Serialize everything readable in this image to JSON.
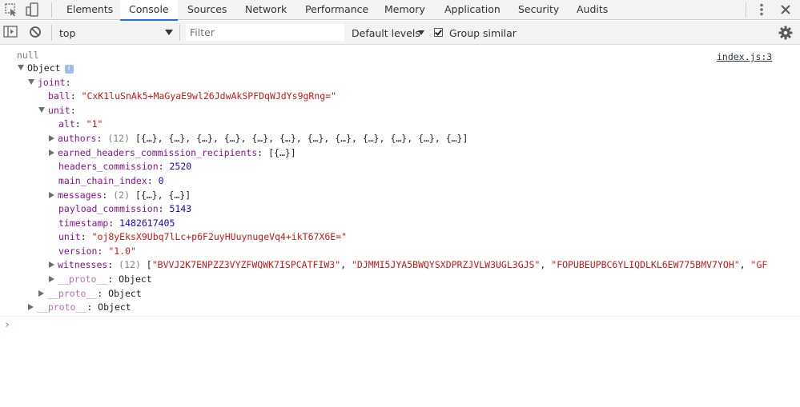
{
  "tabs": [
    {
      "label": "Elements"
    },
    {
      "label": "Console",
      "active": true
    },
    {
      "label": "Sources"
    },
    {
      "label": "Network"
    },
    {
      "label": "Performance"
    },
    {
      "label": "Memory"
    },
    {
      "label": "Application"
    },
    {
      "label": "Security"
    },
    {
      "label": "Audits"
    }
  ],
  "toolbar": {
    "context": "top",
    "filter_placeholder": "Filter",
    "levels": "Default levels",
    "group_similar": "Group similar",
    "group_similar_checked": true
  },
  "console": {
    "null_text": "null",
    "source_link": "index.js:3",
    "root_label": "Object",
    "info_badge": "i",
    "joint_key": "joint",
    "ball_key": "ball",
    "ball_value": "\"CxK1luSnAk5+MaGyaE9wl26JdwAkSPFDqWJdYs9gRng=\"",
    "unit_key": "unit",
    "alt_key": "alt",
    "alt_value": "\"1\"",
    "authors_key": "authors",
    "authors_count": "(12)",
    "authors_preview": "[{…}, {…}, {…}, {…}, {…}, {…}, {…}, {…}, {…}, {…}, {…}, {…}]",
    "earned_key": "earned_headers_commission_recipients",
    "earned_preview": "[{…}]",
    "hc_key": "headers_commission",
    "hc_value": "2520",
    "mci_key": "main_chain_index",
    "mci_value": "0",
    "messages_key": "messages",
    "messages_count": "(2)",
    "messages_preview": "[{…}, {…}]",
    "pc_key": "payload_commission",
    "pc_value": "5143",
    "ts_key": "timestamp",
    "ts_value": "1482617405",
    "unit2_key": "unit",
    "unit2_value": "\"oj8yEksX9Ubq7lLc+p6F2uyHUuynugeVq4+ikT67X6E=\"",
    "version_key": "version",
    "version_value": "\"1.0\"",
    "witnesses_key": "witnesses",
    "witnesses_count": "(12)",
    "w1": "\"BVVJ2K7ENPZZ3VYZFWQWK7ISPCATFIW3\"",
    "w2": "\"DJMMI5JYA5BWQYSXDPRZJVLW3UGL3GJS\"",
    "w3": "\"FOPUBEUPBC6YLIQDLKL6EW775BMV7YOH\"",
    "w4": "\"GF",
    "proto_key": "__proto__",
    "proto_value": "Object",
    "prompt": "›"
  }
}
